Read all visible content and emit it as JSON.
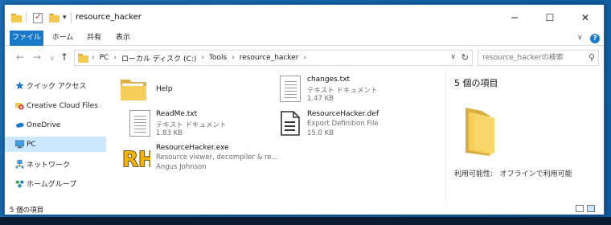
{
  "window": {
    "title": "resource_hacker"
  },
  "window_controls": {
    "minimize": "─",
    "maximize": "☐",
    "close": "✕"
  },
  "ribbon": {
    "tabs": [
      {
        "label": "ファイル"
      },
      {
        "label": "ホーム"
      },
      {
        "label": "共有"
      },
      {
        "label": "表示"
      }
    ]
  },
  "address": {
    "crumbs": [
      "PC",
      "ローカル ディスク (C:)",
      "Tools",
      "resource_hacker"
    ]
  },
  "search": {
    "placeholder": "resource_hackerの検索"
  },
  "sidebar": {
    "items": [
      {
        "label": "クイック アクセス",
        "icon": "star-icon"
      },
      {
        "label": "Creative Cloud Files",
        "icon": "creative-cloud-icon"
      },
      {
        "label": "OneDrive",
        "icon": "cloud-icon"
      },
      {
        "label": "PC",
        "icon": "computer-icon",
        "selected": true
      },
      {
        "label": "ネットワーク",
        "icon": "network-icon"
      },
      {
        "label": "ホームグループ",
        "icon": "homegroup-icon"
      }
    ]
  },
  "files": [
    {
      "name": "Help",
      "type": "",
      "detail": "",
      "icon": "folder-icon"
    },
    {
      "name": "changes.txt",
      "type": "テキスト ドキュメント",
      "detail": "1.47 KB",
      "icon": "text-document-icon"
    },
    {
      "name": "ReadMe.txt",
      "type": "テキスト ドキュメント",
      "detail": "1.83 KB",
      "icon": "text-document-icon"
    },
    {
      "name": "ResourceHacker.def",
      "type": "Export Definition File",
      "detail": "15.0 KB",
      "icon": "definition-file-icon"
    },
    {
      "name": "ResourceHacker.exe",
      "type": "Resource viewer, decompiler & re...",
      "detail": "Angus Johnson",
      "icon": "resource-hacker-icon"
    }
  ],
  "exe_icon_text": "RH",
  "details": {
    "title": "5 個の項目",
    "availability_label": "利用可能性:",
    "availability_value": "オフラインで利用可能"
  },
  "status": {
    "text": "5 個の項目"
  },
  "colors": {
    "accent": "#1979ca",
    "selected": "#cce8ff",
    "folder": "#f3c950",
    "desktop": "#1566a8"
  }
}
